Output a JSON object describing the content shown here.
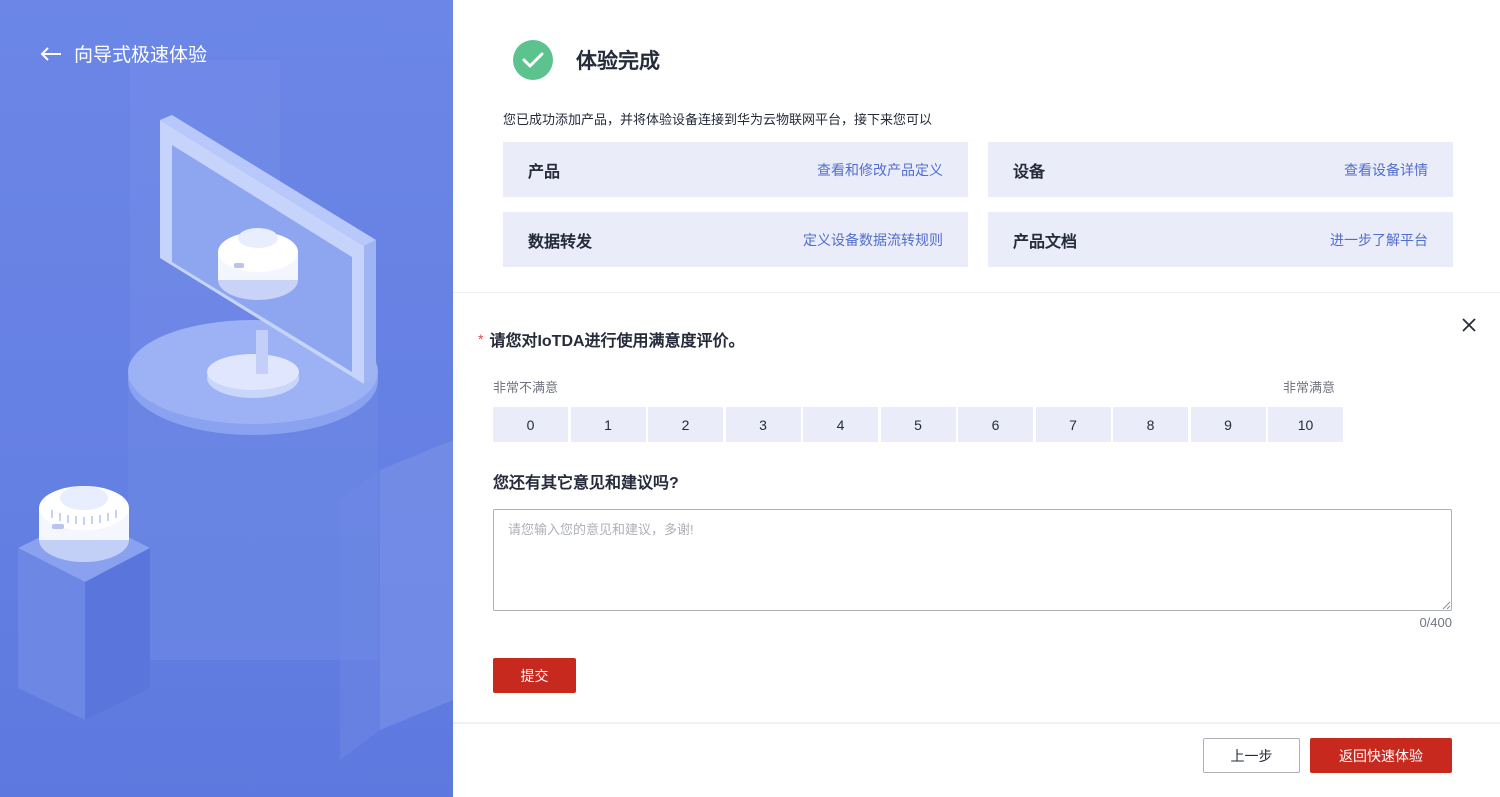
{
  "left": {
    "back_label": "向导式极速体验"
  },
  "header": {
    "title": "体验完成",
    "description": "您已成功添加产品，并将体验设备连接到华为云物联网平台，接下来您可以"
  },
  "cards": [
    {
      "title": "产品",
      "link": "查看和修改产品定义"
    },
    {
      "title": "设备",
      "link": "查看设备详情"
    },
    {
      "title": "数据转发",
      "link": "定义设备数据流转规则"
    },
    {
      "title": "产品文档",
      "link": "进一步了解平台"
    }
  ],
  "survey": {
    "required_mark": "*",
    "question1": "请您对IoTDA进行使用满意度评价。",
    "scale_low": "非常不满意",
    "scale_high": "非常满意",
    "scores": [
      "0",
      "1",
      "2",
      "3",
      "4",
      "5",
      "6",
      "7",
      "8",
      "9",
      "10"
    ],
    "question2": "您还有其它意见和建议吗?",
    "feedback_placeholder": "请您输入您的意见和建议，多谢!",
    "feedback_value": "",
    "counter": "0/400",
    "submit_label": "提交"
  },
  "footer": {
    "prev_label": "上一步",
    "return_label": "返回快速体验"
  },
  "colors": {
    "left_bg": "#6580e3",
    "success": "#5cc38f",
    "card_bg": "#eaedf9",
    "link": "#526ecc",
    "primary_button": "#c7291f",
    "required": "#e54545"
  }
}
